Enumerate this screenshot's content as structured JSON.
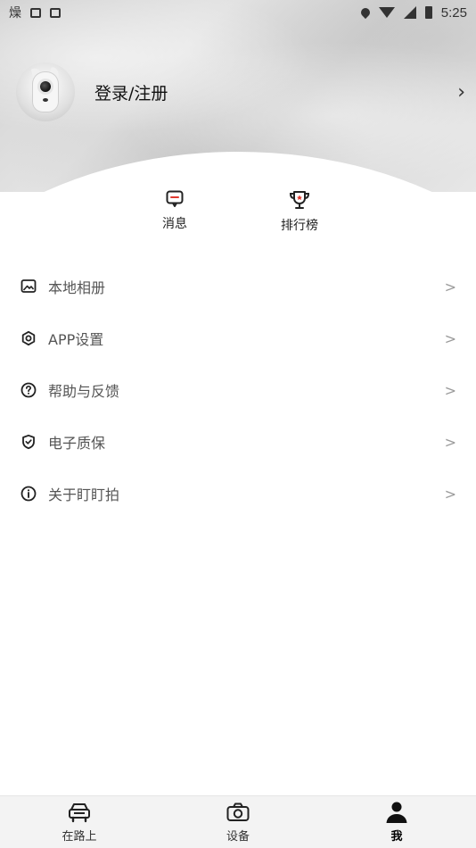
{
  "status_bar": {
    "time": "5:25",
    "left_icons": [
      "weather-icon",
      "message-icon",
      "a-icon"
    ],
    "right_icons": [
      "location-icon",
      "wifi-icon",
      "signal-icon",
      "battery-icon"
    ]
  },
  "profile": {
    "login_label": "登录/注册"
  },
  "quick_actions": [
    {
      "label": "消息",
      "icon": "message-icon"
    },
    {
      "label": "排行榜",
      "icon": "trophy-icon"
    }
  ],
  "menu": [
    {
      "label": "本地相册",
      "icon": "album-icon"
    },
    {
      "label": "APP设置",
      "icon": "settings-icon"
    },
    {
      "label": "帮助与反馈",
      "icon": "help-icon"
    },
    {
      "label": "电子质保",
      "icon": "shield-icon"
    },
    {
      "label": "关于盯盯拍",
      "icon": "info-icon"
    }
  ],
  "bottom_nav": [
    {
      "label": "在路上",
      "icon": "car-icon"
    },
    {
      "label": "设备",
      "icon": "camera-icon"
    },
    {
      "label": "我",
      "icon": "person-icon",
      "active": true
    }
  ],
  "colors": {
    "accent_red": "#e0392f",
    "text_dark": "#111111",
    "text_menu": "#555555",
    "nav_bg": "#f3f3f3"
  }
}
